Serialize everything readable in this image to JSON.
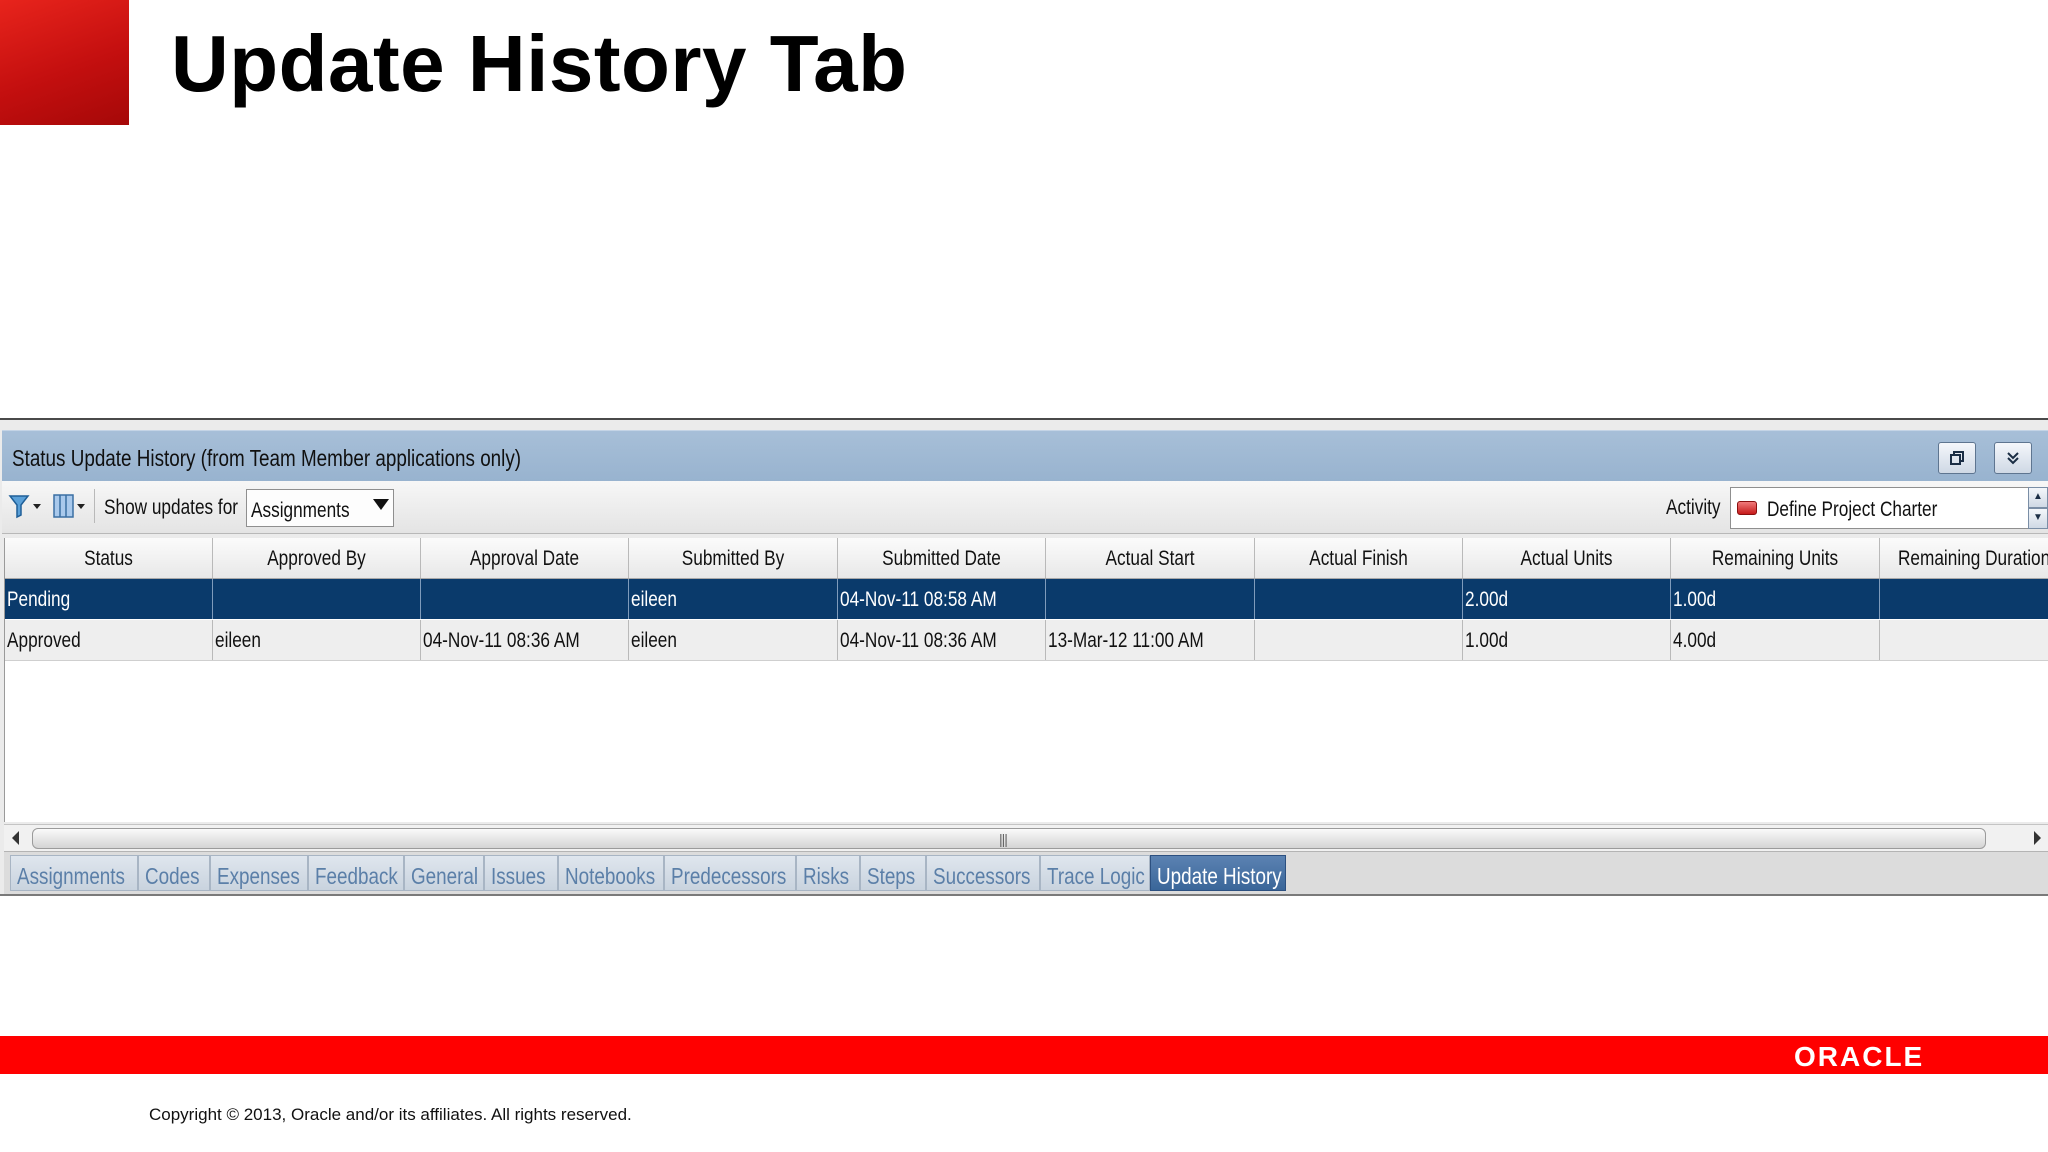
{
  "slide": {
    "title": "Update History Tab",
    "copyright": "Copyright © 2013, Oracle and/or its affiliates. All rights reserved.",
    "logo_text": "ORACLE",
    "brand_color": "#ff0000"
  },
  "panel": {
    "title": "Status Update History (from Team Member applications only)",
    "toolbar": {
      "show_updates_label": "Show updates for",
      "show_updates_value": "Assignments",
      "activity_label": "Activity",
      "activity_value": "Define Project Charter"
    },
    "columns": [
      "Status",
      "Approved By",
      "Approval Date",
      "Submitted By",
      "Submitted Date",
      "Actual Start",
      "Actual Finish",
      "Actual Units",
      "Remaining Units",
      "Remaining Duration"
    ],
    "rows": [
      [
        "Pending",
        "",
        "",
        "eileen",
        "04-Nov-11 08:58 AM",
        "",
        "",
        "2.00d",
        "1.00d",
        ""
      ],
      [
        "Approved",
        "eileen",
        "04-Nov-11 08:36 AM",
        "eileen",
        "04-Nov-11 08:36 AM",
        "13-Mar-12 11:00 AM",
        "",
        "1.00d",
        "4.00d",
        ""
      ]
    ],
    "selected_row_color": "#0a3a6b",
    "tabs": [
      "Assignments",
      "Codes",
      "Expenses",
      "Feedback",
      "General",
      "Issues",
      "Notebooks",
      "Predecessors",
      "Risks",
      "Steps",
      "Successors",
      "Trace Logic",
      "Update History"
    ],
    "active_tab": "Update History"
  }
}
